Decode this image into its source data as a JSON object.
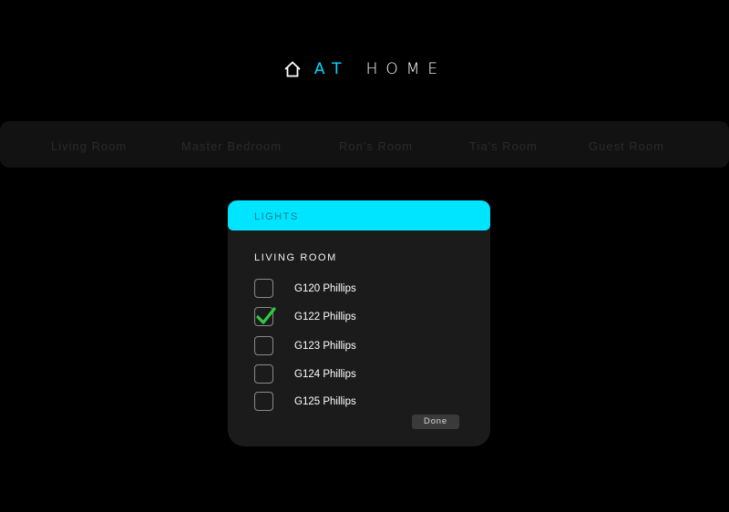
{
  "app": {
    "logo_word1": "AT",
    "logo_word2": "HOME",
    "logo_icon": "home-icon"
  },
  "rooms": [
    {
      "label": "Living Room"
    },
    {
      "label": "Master Bedroom"
    },
    {
      "label": "Ron's Room"
    },
    {
      "label": "Tia's Room"
    },
    {
      "label": "Guest Room"
    }
  ],
  "panel": {
    "header": "LIGHTS",
    "room_title": "LIVING ROOM",
    "lights": [
      {
        "name": "G120 Phillips",
        "checked": false
      },
      {
        "name": "G122 Phillips",
        "checked": true
      },
      {
        "name": "G123 Phillips",
        "checked": false
      },
      {
        "name": "G124 Phillips",
        "checked": false
      },
      {
        "name": "G125 Phillips",
        "checked": false
      }
    ],
    "done_label": "Done"
  },
  "colors": {
    "accent": "#00e5ff",
    "check": "#2ecc40",
    "background": "#000000",
    "panel": "#1b1b1b"
  }
}
